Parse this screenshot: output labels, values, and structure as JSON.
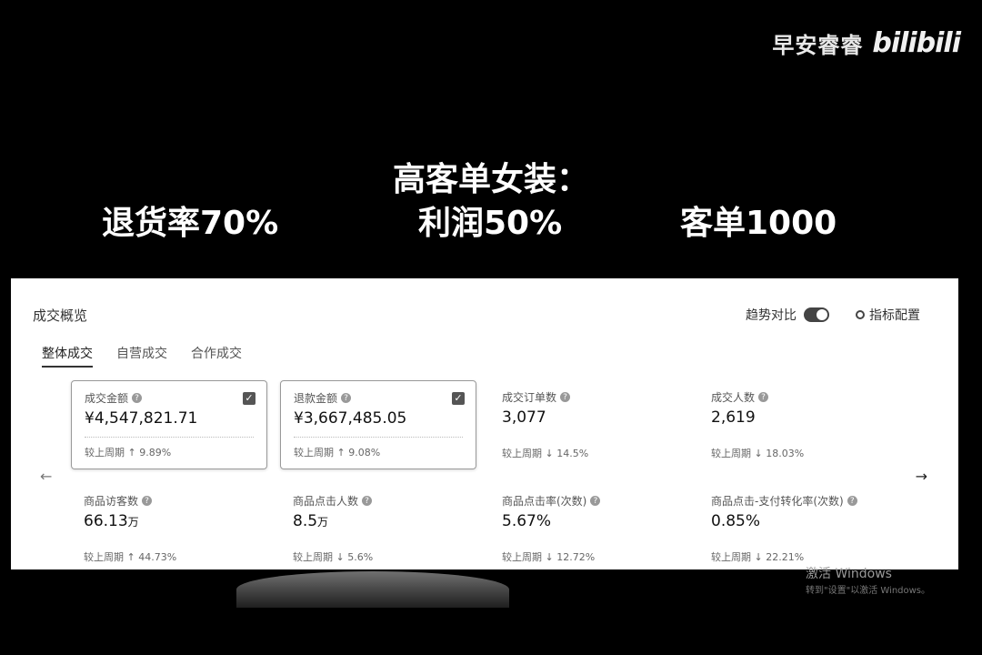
{
  "brand": {
    "name": "早安睿睿",
    "logo": "bilibili"
  },
  "caption": {
    "title": "高客单女装：",
    "items": [
      "退货率70%",
      "利润50%",
      "客单1000"
    ]
  },
  "panel": {
    "title": "成交概览",
    "trend_label": "趋势对比",
    "config_label": "指标配置",
    "tabs": [
      "整体成交",
      "自营成交",
      "合作成交"
    ],
    "cards": [
      {
        "label": "成交金额",
        "value": "¥4,547,821.71",
        "compare": "较上周期 ↑ 9.89%",
        "checked": true
      },
      {
        "label": "退款金额",
        "value": "¥3,667,485.05",
        "compare": "较上周期 ↑ 9.08%",
        "checked": true
      },
      {
        "label": "成交订单数",
        "value": "3,077",
        "compare": "较上周期 ↓ 14.5%"
      },
      {
        "label": "成交人数",
        "value": "2,619",
        "compare": "较上周期 ↓ 18.03%"
      },
      {
        "label": "商品访客数",
        "value": "66.13",
        "unit": "万",
        "compare": "较上周期 ↑ 44.73%"
      },
      {
        "label": "商品点击人数",
        "value": "8.5",
        "unit": "万",
        "compare": "较上周期 ↓ 5.6%"
      },
      {
        "label": "商品点击率(次数)",
        "value": "5.67%",
        "compare": "较上周期 ↓ 12.72%"
      },
      {
        "label": "商品点击-支付转化率(次数)",
        "value": "0.85%",
        "compare": "较上周期 ↓ 22.21%"
      }
    ]
  },
  "watermark": {
    "line1": "激活 Windows",
    "line2": "转到\"设置\"以激活 Windows。"
  }
}
